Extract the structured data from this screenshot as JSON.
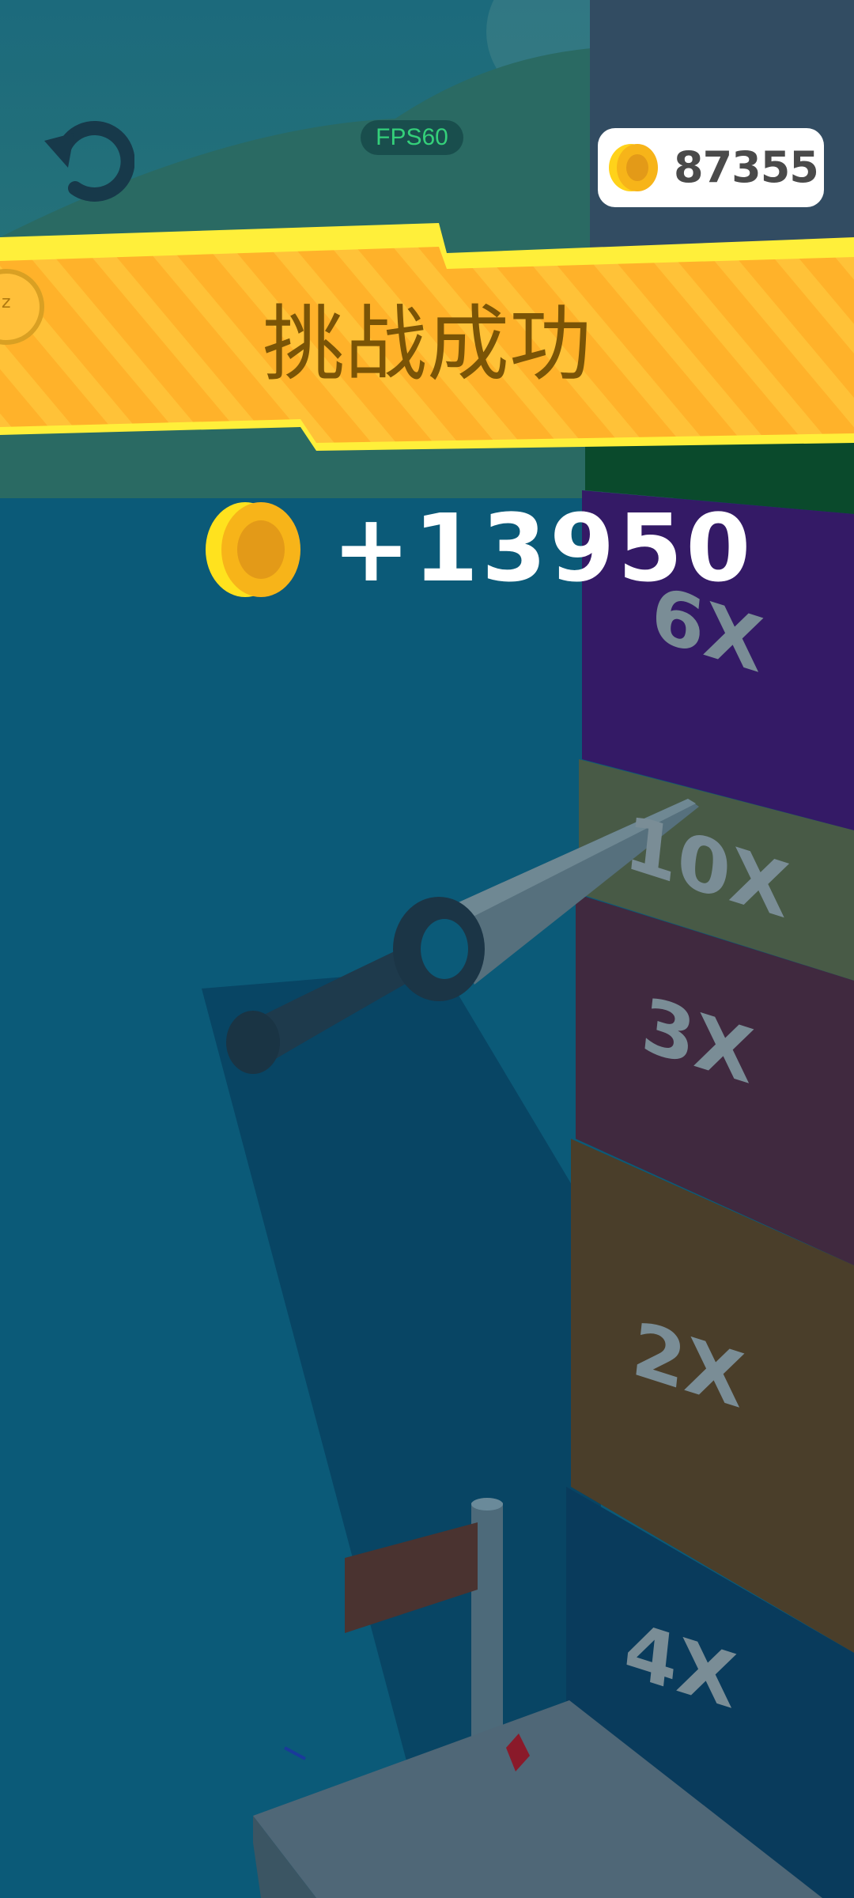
{
  "hud": {
    "fps_label": "FPS60",
    "coins_total": "87355"
  },
  "banner": {
    "title": "挑战成功"
  },
  "reward": {
    "amount": "+13950"
  },
  "tower": {
    "segments": [
      "6X",
      "10X",
      "3X",
      "2X",
      "4X"
    ]
  },
  "colors": {
    "banner": "#ffb52a",
    "banner_edge": "#ffef3a",
    "coin": "#f7b419",
    "water": "#0b5a78"
  },
  "icons": {
    "restart": "restart-icon",
    "coin": "coin-icon",
    "side_badge": "sleep-badge-icon"
  }
}
